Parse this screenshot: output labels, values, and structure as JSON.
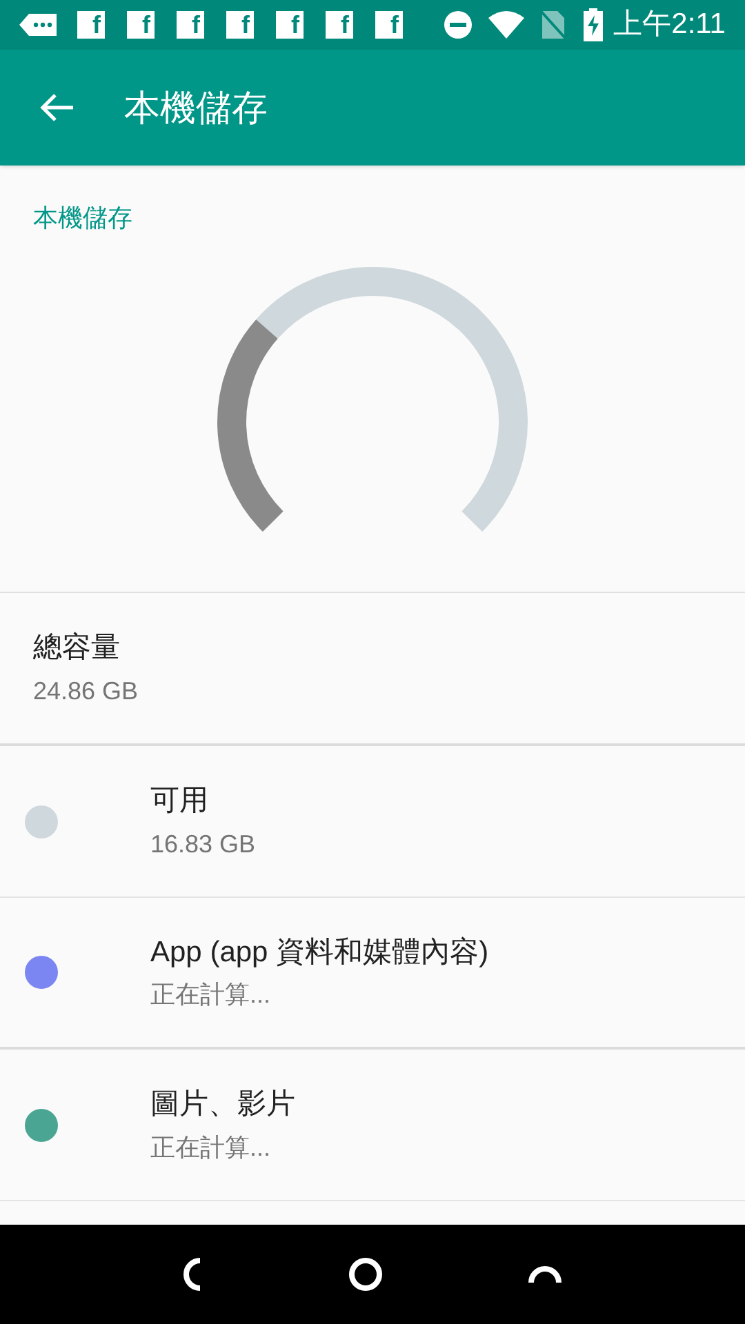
{
  "status_bar": {
    "notifications": [
      "f",
      "f",
      "f",
      "f",
      "f",
      "f",
      "f"
    ],
    "time": "上午2:11"
  },
  "app_bar": {
    "title": "本機儲存"
  },
  "section_title": "本機儲存",
  "total": {
    "label": "總容量",
    "value": "24.86 GB"
  },
  "items": [
    {
      "label": "可用",
      "value": "16.83 GB",
      "color": "#cfd8dc"
    },
    {
      "label": "App (app 資料和媒體內容)",
      "value": "正在計算...",
      "color": "#7c86f2"
    },
    {
      "label": "圖片、影片",
      "value": "正在計算...",
      "color": "#4aa593"
    }
  ]
}
